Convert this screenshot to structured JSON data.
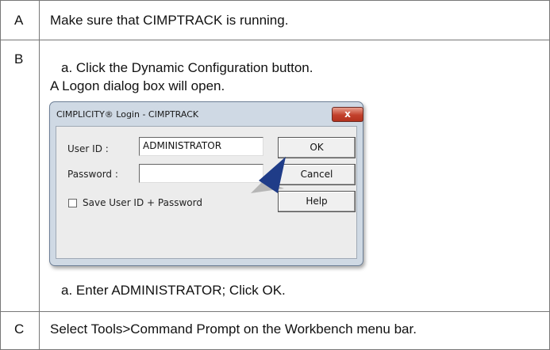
{
  "steps": [
    {
      "letter": "A",
      "text": "Make sure that CIMPTRACK is running."
    },
    {
      "letter": "B",
      "step_a": "a. Click the Dynamic Configuration button.",
      "note": "A Logon dialog box will open.",
      "step_b": "a. Enter ADMINISTRATOR; Click OK."
    },
    {
      "letter": "C",
      "text": "Select Tools>Command Prompt on the Workbench menu bar."
    }
  ],
  "dialog": {
    "title": "CIMPLICITY® Login - CIMPTRACK",
    "close_glyph": "x",
    "user_id_label": "User ID :",
    "user_id_value": "ADMINISTRATOR",
    "password_label": "Password :",
    "password_value": "",
    "save_label": "Save User ID + Password",
    "save_checked": false,
    "ok_label": "OK",
    "cancel_label": "Cancel",
    "help_label": "Help"
  },
  "colors": {
    "arrow": "#1f3c88",
    "close_button": "#c2402b"
  }
}
